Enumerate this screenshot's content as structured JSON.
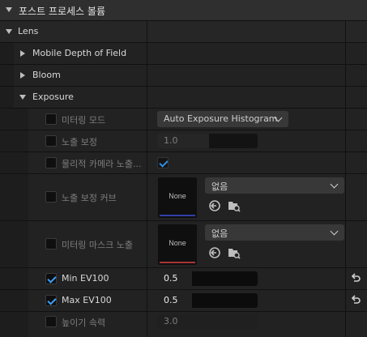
{
  "section": {
    "title": "포스트 프로세스 볼륨"
  },
  "category": {
    "label": "Lens"
  },
  "groups": {
    "dof": "Mobile Depth of Field",
    "bloom": "Bloom",
    "exposure": "Exposure"
  },
  "props": {
    "metering_mode": {
      "label": "미터링 모드",
      "value": "Auto Exposure Histogram"
    },
    "exposure_comp": {
      "label": "노출 보정",
      "value": "1.0"
    },
    "physical_camera": {
      "label": "물리적 카메라 노출...",
      "checked": true
    },
    "exposure_curve": {
      "label": "노출 보정 커브",
      "asset": "없음",
      "thumb": "None"
    },
    "metering_mask": {
      "label": "미터링 마스크 노출",
      "asset": "없음",
      "thumb": "None"
    },
    "min_ev": {
      "label": "Min EV100",
      "value": "0.5",
      "checked": true
    },
    "max_ev": {
      "label": "Max EV100",
      "value": "0.5",
      "checked": true
    },
    "speed_up": {
      "label": "높이기 속력",
      "value": "3.0"
    }
  },
  "colors": {
    "accent_blue": "#2f8fe0",
    "curve_bar": "#3340a8",
    "mask_bar": "#a83333"
  },
  "icons": [
    "chevron-down-icon",
    "chevron-right-icon",
    "checkmark-icon",
    "browse-icon",
    "use-selected-icon",
    "reset-arrow-icon"
  ]
}
